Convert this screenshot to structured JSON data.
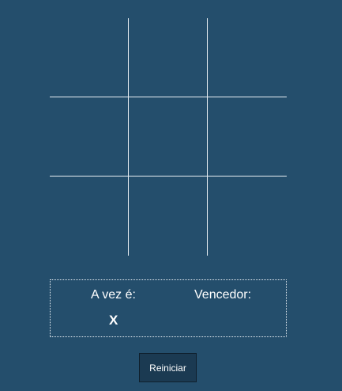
{
  "board": {
    "cells": [
      "",
      "",
      "",
      "",
      "",
      "",
      "",
      "",
      ""
    ]
  },
  "status": {
    "turn_label": "A vez é:",
    "turn_value": "X",
    "winner_label": "Vencedor:",
    "winner_value": ""
  },
  "controls": {
    "restart_label": "Reiniciar"
  },
  "colors": {
    "background": "#244e6c",
    "grid_lines": "#e8eef3",
    "button_bg": "#1b3a52"
  }
}
